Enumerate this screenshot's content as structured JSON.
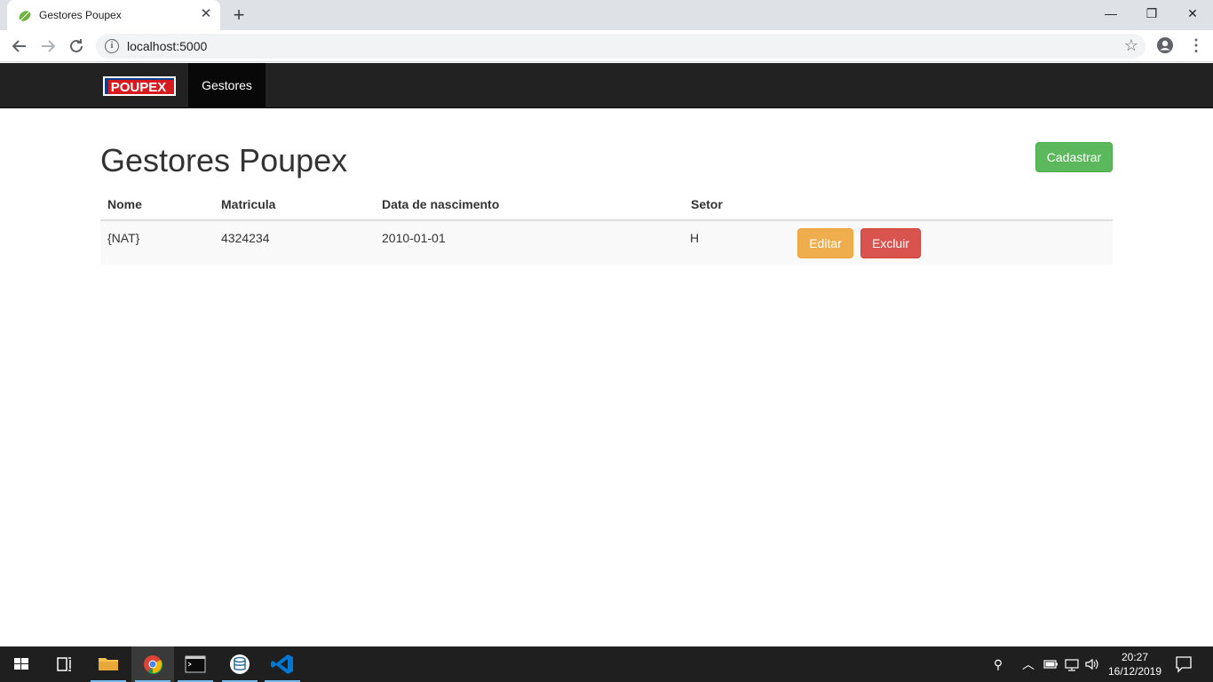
{
  "browser": {
    "tab_title": "Gestores Poupex",
    "tab_close_glyph": "✕",
    "new_tab_glyph": "+",
    "url": "localhost:5000",
    "window_controls": [
      "—",
      "❐",
      "✕"
    ],
    "icons": [
      "spring-leaf-favicon",
      "back-arrow-icon",
      "forward-arrow-icon",
      "reload-icon",
      "info-icon",
      "star-icon",
      "profile-icon",
      "menu-icon"
    ]
  },
  "navbar": {
    "brand": "POUPEX",
    "active_link": "Gestores"
  },
  "page": {
    "title": "Gestores Poupex",
    "register_button": "Cadastrar",
    "table": {
      "headers": [
        "Nome",
        "Matricula",
        "Data de nascimento",
        "Setor"
      ],
      "rows": [
        {
          "nome": "{NAT}",
          "matricula": "4324234",
          "data_nascimento": "2010-01-01",
          "setor": "H",
          "edit_label": "Editar",
          "delete_label": "Excluir"
        }
      ]
    }
  },
  "taskbar": {
    "time": "20:27",
    "date": "16/12/2019",
    "apps": [
      "windows-start-icon",
      "task-view-icon",
      "file-explorer-icon",
      "chrome-icon",
      "terminal-icon",
      "database-icon",
      "vscode-icon"
    ]
  },
  "colors": {
    "navbar_bg": "#222222",
    "success": "#5cb85c",
    "warning": "#f0ad4e",
    "danger": "#d9534f"
  }
}
